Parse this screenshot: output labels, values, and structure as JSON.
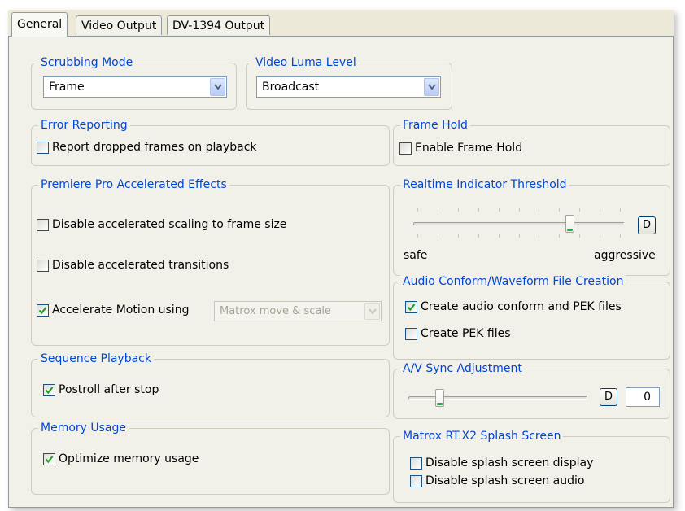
{
  "tabs": [
    {
      "label": "General",
      "active": true
    },
    {
      "label": "Video Output",
      "active": false
    },
    {
      "label": "DV-1394 Output",
      "active": false
    }
  ],
  "scrubbing_mode": {
    "title": "Scrubbing Mode",
    "value": "Frame"
  },
  "video_luma_level": {
    "title": "Video Luma Level",
    "value": "Broadcast"
  },
  "error_reporting": {
    "title": "Error Reporting",
    "report_dropped": {
      "label": "Report dropped frames on playback",
      "checked": false
    }
  },
  "accelerated_effects": {
    "title": "Premiere Pro Accelerated Effects",
    "disable_scaling": {
      "label": "Disable accelerated scaling to frame size",
      "checked": false
    },
    "disable_transitions": {
      "label": "Disable accelerated transitions",
      "checked": false
    },
    "accelerate_motion": {
      "label": "Accelerate Motion using",
      "checked": true
    },
    "motion_method": "Matrox move & scale"
  },
  "sequence_playback": {
    "title": "Sequence Playback",
    "postroll": {
      "label": "Postroll after stop",
      "checked": true
    }
  },
  "memory_usage": {
    "title": "Memory Usage",
    "optimize": {
      "label": "Optimize memory usage",
      "checked": true
    }
  },
  "frame_hold": {
    "title": "Frame Hold",
    "enable": {
      "label": "Enable Frame Hold",
      "checked": false
    }
  },
  "realtime_threshold": {
    "title": "Realtime Indicator Threshold",
    "default_label": "D",
    "min_label": "safe",
    "max_label": "aggressive",
    "level_fraction": 0.75
  },
  "audio_conform": {
    "title": "Audio Conform/Waveform File Creation",
    "create_conform_pek": {
      "label": "Create audio conform and PEK files",
      "checked": true
    },
    "create_pek": {
      "label": "Create PEK files",
      "checked": false
    }
  },
  "av_sync": {
    "title": "A/V Sync Adjustment",
    "default_label": "D",
    "value": "0",
    "level_fraction": 0.16
  },
  "splash_screen": {
    "title": "Matrox RT.X2 Splash Screen",
    "disable_display": {
      "label": "Disable splash screen display",
      "checked": false
    },
    "disable_audio": {
      "label": "Disable splash screen audio",
      "checked": false
    }
  },
  "colors": {
    "group_title": "#0046d5",
    "check": "#21a121",
    "panel": "#f1f1ea"
  }
}
